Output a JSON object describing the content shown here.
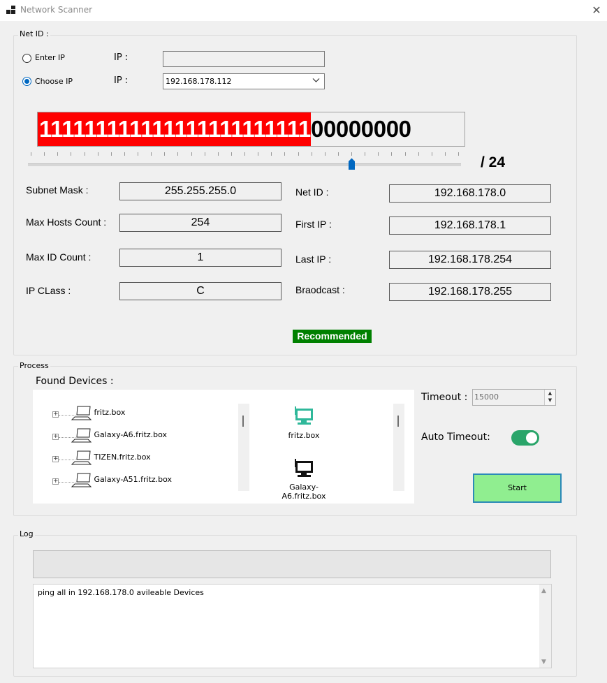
{
  "window": {
    "title": "Network Scanner",
    "close_glyph": "✕"
  },
  "netid_group": {
    "label": "Net ID :",
    "enter_ip": {
      "label": "Enter IP",
      "checked": false,
      "ip_label": "IP  :",
      "value": ""
    },
    "choose_ip": {
      "label": "Choose IP",
      "checked": true,
      "ip_label": "IP :",
      "selected": "192.168.178.112"
    }
  },
  "subnet_bits": {
    "ones": "111111111111111111111111",
    "zeros": "00000000"
  },
  "slider": {
    "min": 0,
    "max": 32,
    "value": 24,
    "label": "/ 24"
  },
  "fields_left": [
    {
      "label": "Subnet Mask  :",
      "value": "255.255.255.0"
    },
    {
      "label": "Max Hosts Count  :",
      "value": "254"
    },
    {
      "label": "Max ID Count :",
      "value": "1"
    },
    {
      "label": "IP CLass :",
      "value": "C"
    }
  ],
  "fields_right": [
    {
      "label": "Net ID :",
      "value": "192.168.178.0"
    },
    {
      "label": "First IP  :",
      "value": "192.168.178.1"
    },
    {
      "label": "Last IP :",
      "value": "192.168.178.254"
    },
    {
      "label": "Braodcast  :",
      "value": "192.168.178.255"
    }
  ],
  "recommended_badge": "Recommended",
  "process_group": {
    "label": "Process",
    "found_devices_label": "Found Devices :",
    "tree_items": [
      "fritz.box",
      "Galaxy-A6.fritz.box",
      "TIZEN.fritz.box",
      "Galaxy-A51.fritz.box"
    ],
    "icon_items": [
      {
        "label": "fritz.box",
        "icon": "router-monitor-icon"
      },
      {
        "label": "Galaxy-A6.fritz.box",
        "icon": "monitor-icon"
      }
    ],
    "timeout_label": "Timeout :",
    "timeout_value": "15000",
    "auto_timeout_label": "Auto Timeout:",
    "auto_timeout_on": true,
    "start_label": "Start"
  },
  "log_group": {
    "label": "Log",
    "progress": 0,
    "lines": [
      "ping all in 192.168.178.0 avileable Devices"
    ]
  },
  "colors": {
    "ones_bg": "#ff0000",
    "badge_bg": "#008000",
    "toggle_on": "#2aa56a",
    "start_bg": "#90ee90",
    "accent": "#0067c0"
  }
}
